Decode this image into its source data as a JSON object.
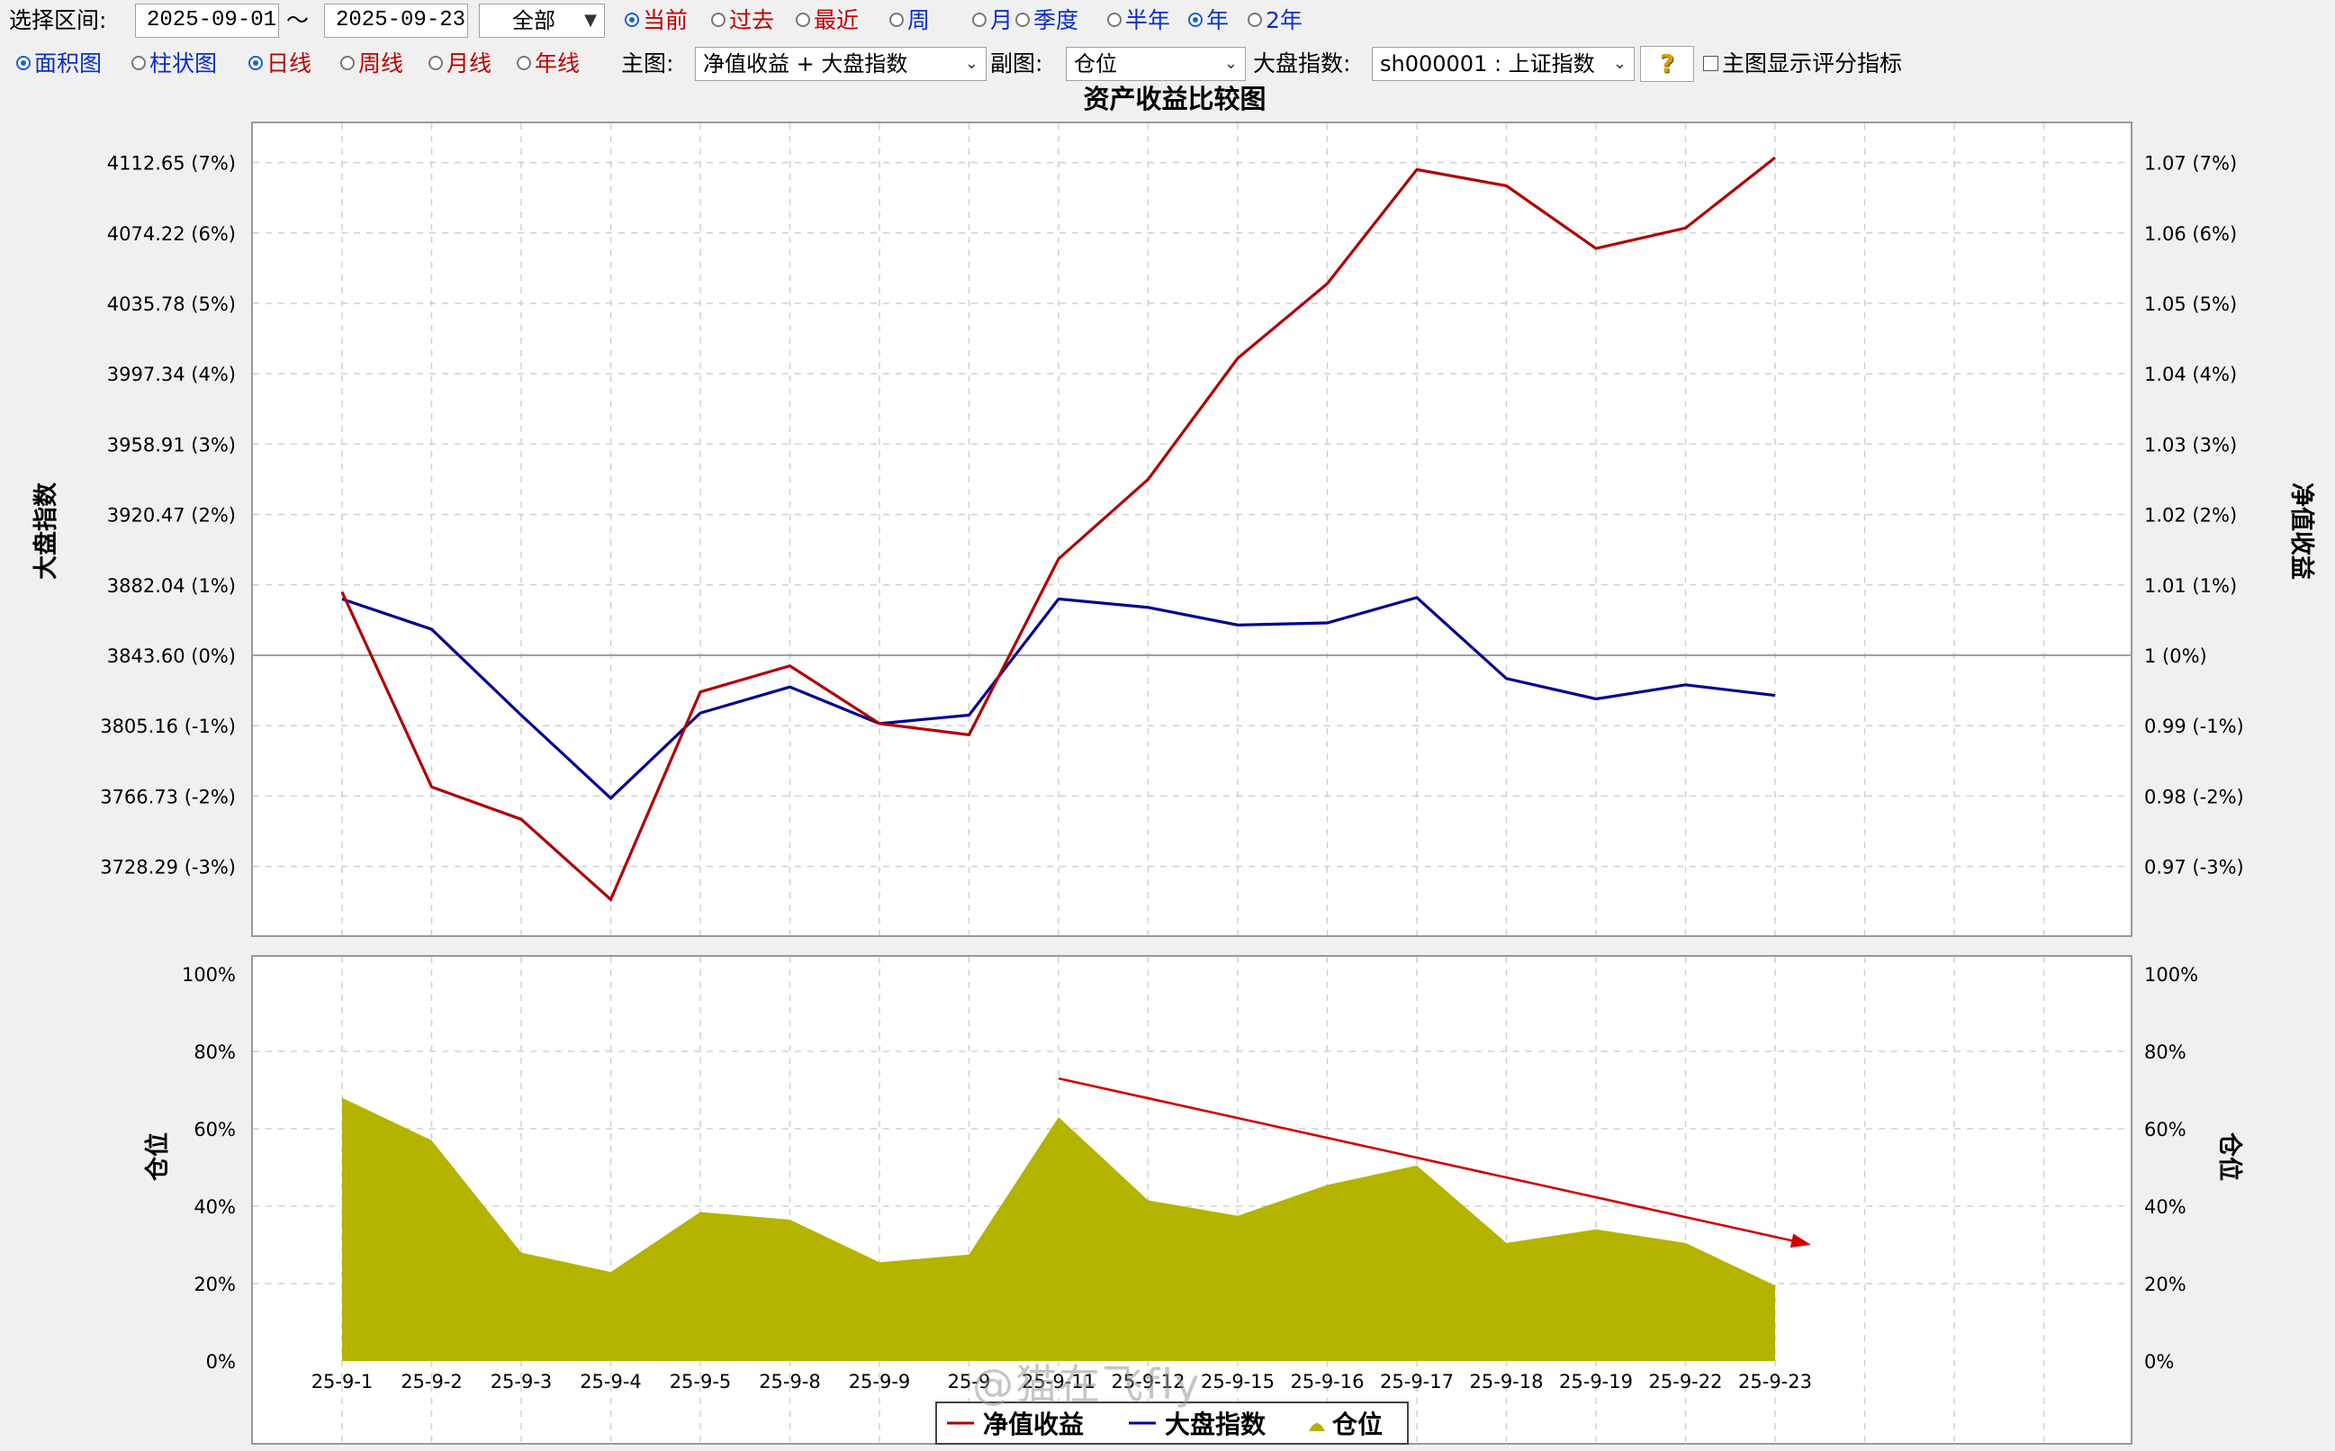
{
  "toolbar1": {
    "range_label": "选择区间:",
    "date_from": "2025-09-01",
    "tilde": "～",
    "date_to": "2025-09-23",
    "scope_select": "全部",
    "period_options": [
      {
        "label": "当前",
        "checked": true,
        "color": "red"
      },
      {
        "label": "过去",
        "checked": false,
        "color": "red"
      },
      {
        "label": "最近",
        "checked": false,
        "color": "red"
      },
      {
        "label": "周",
        "checked": false,
        "color": "blue"
      },
      {
        "label": "月",
        "checked": false,
        "color": "blue"
      },
      {
        "label": "季度",
        "checked": false,
        "color": "blue"
      },
      {
        "label": "半年",
        "checked": false,
        "color": "blue"
      },
      {
        "label": "年",
        "checked": true,
        "color": "blue"
      },
      {
        "label": "2年",
        "checked": false,
        "color": "blue"
      }
    ]
  },
  "toolbar2": {
    "chart_types": [
      {
        "label": "面积图",
        "checked": true,
        "color": "blue"
      },
      {
        "label": "柱状图",
        "checked": false,
        "color": "blue"
      }
    ],
    "line_types": [
      {
        "label": "日线",
        "checked": true,
        "color": "red"
      },
      {
        "label": "周线",
        "checked": false,
        "color": "red"
      },
      {
        "label": "月线",
        "checked": false,
        "color": "red"
      },
      {
        "label": "年线",
        "checked": false,
        "color": "red"
      }
    ],
    "main_label": "主图:",
    "main_select": "净值收益 + 大盘指数",
    "sub_label": "副图:",
    "sub_select": "仓位",
    "index_label": "大盘指数:",
    "index_select": "sh000001 : 上证指数",
    "help_icon": "question-bulb-icon",
    "score_checkbox_label": "主图显示评分指标",
    "score_checked": false
  },
  "chart_data": [
    {
      "type": "line",
      "title": "资产收益比较图",
      "ylabel_left": "大盘指数",
      "ylabel_right": "净值收益",
      "y_ticks_left": [
        "4112.65 (7%)",
        "4074.22 (6%)",
        "4035.78 (5%)",
        "3997.34 (4%)",
        "3958.91 (3%)",
        "3920.47 (2%)",
        "3882.04 (1%)",
        "3843.60 (0%)",
        "3805.16 (-1%)",
        "3766.73 (-2%)",
        "3728.29 (-3%)"
      ],
      "y_ticks_right": [
        "1.07 (7%)",
        "1.06 (6%)",
        "1.05 (5%)",
        "1.04 (4%)",
        "1.03 (3%)",
        "1.02 (2%)",
        "1.01 (1%)",
        "1 (0%)",
        "0.99 (-1%)",
        "0.98 (-2%)",
        "0.97 (-3%)"
      ],
      "ylim_pct": [
        -3.6,
        7.0
      ],
      "categories": [
        "25-9-1",
        "25-9-2",
        "25-9-3",
        "25-9-4",
        "25-9-5",
        "25-9-8",
        "25-9-9",
        "25-9-10",
        "25-9-11",
        "25-9-12",
        "25-9-15",
        "25-9-16",
        "25-9-17",
        "25-9-18",
        "25-9-19",
        "25-9-22",
        "25-9-23"
      ],
      "series": [
        {
          "name": "净值收益",
          "color": "#b00000",
          "values_pct": [
            0.9,
            -1.87,
            -2.33,
            -3.47,
            -0.52,
            -0.15,
            -0.97,
            -1.13,
            1.37,
            2.5,
            4.22,
            5.28,
            6.9,
            6.67,
            5.78,
            6.07,
            7.07
          ]
        },
        {
          "name": "大盘指数",
          "color": "#000090",
          "values_pct": [
            0.8,
            0.37,
            -0.85,
            -2.03,
            -0.82,
            -0.45,
            -0.97,
            -0.85,
            0.8,
            0.68,
            0.43,
            0.46,
            0.82,
            -0.33,
            -0.62,
            -0.42,
            -0.57
          ]
        }
      ],
      "grid": true
    },
    {
      "type": "area",
      "ylabel_left": "仓位",
      "ylabel_right": "仓位",
      "y_ticks": [
        "0%",
        "20%",
        "40%",
        "60%",
        "80%",
        "100%"
      ],
      "ylim": [
        0,
        100
      ],
      "categories": [
        "25-9-1",
        "25-9-2",
        "25-9-3",
        "25-9-4",
        "25-9-5",
        "25-9-8",
        "25-9-9",
        "25-9-10",
        "25-9-11",
        "25-9-12",
        "25-9-15",
        "25-9-16",
        "25-9-17",
        "25-9-18",
        "25-9-19",
        "25-9-22",
        "25-9-23"
      ],
      "x_tick_labels": [
        "25-9-1",
        "25-9-2",
        "25-9-3",
        "25-9-4",
        "25-9-5",
        "25-9-8",
        "25-9-9",
        "25-9",
        "25-9-11",
        "25-9-12",
        "25-9-15",
        "25-9-16",
        "25-9-17",
        "25-9-18",
        "25-9-19",
        "25-9-22",
        "25-9-23"
      ],
      "series": [
        {
          "name": "仓位",
          "color": "#b3b300",
          "values": [
            68,
            57,
            28,
            23,
            38.5,
            36.5,
            25.5,
            27.5,
            63,
            41.5,
            37.5,
            45.5,
            50.5,
            30.5,
            34,
            30.5,
            19.5
          ]
        }
      ],
      "trend_arrow": {
        "color": "#d00000",
        "from": {
          "category": "25-9-11",
          "value": 73
        },
        "to": {
          "category": "25-9-23",
          "value": 30
        }
      },
      "grid": true
    }
  ],
  "legend": [
    {
      "label": "净值收益",
      "color": "#b00000",
      "marker": "line"
    },
    {
      "label": "大盘指数",
      "color": "#000090",
      "marker": "line"
    },
    {
      "label": "仓位",
      "color": "#b3b300",
      "marker": "area"
    }
  ],
  "watermark": "@猫在飞fly"
}
